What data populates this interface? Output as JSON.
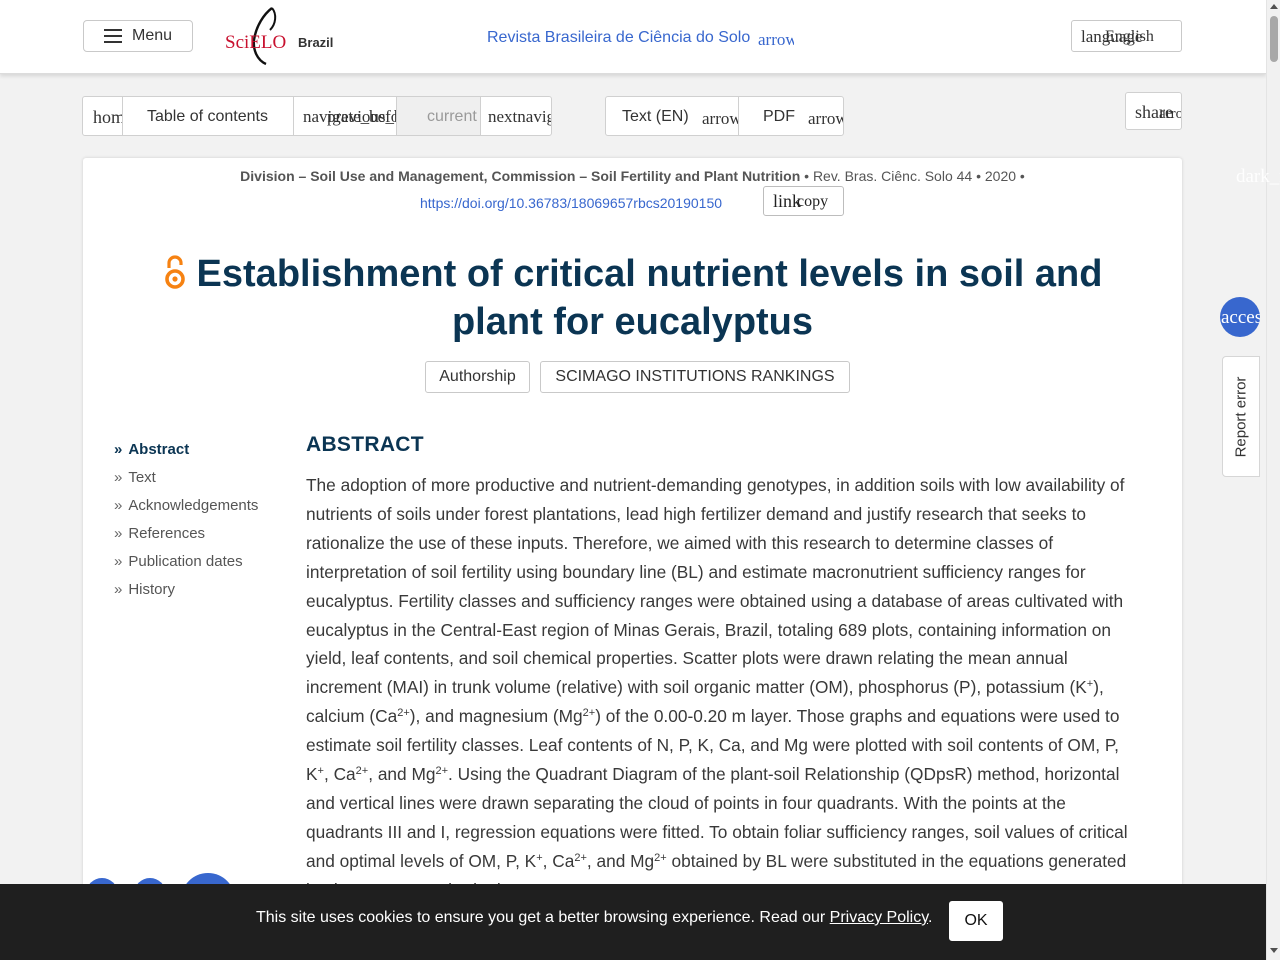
{
  "header": {
    "menu_label": "Menu",
    "logo_text": "SciELO",
    "country": "Brazil",
    "journal_name": "Revista Brasileira de Ciência do Solo",
    "journal_arrow_glyph": "arrow_drop_down",
    "language_glyph_a": "language",
    "language_label": "English",
    "language_arrow_glyph": "arrow_drop_down"
  },
  "toolbar": {
    "home_glyph": "home",
    "toc_label": "Table of contents",
    "prev_glyph_a": "navigate_before",
    "prev_glyph_b": "previous_before",
    "current_label": "current",
    "next_glyph": "nextnavigate_next",
    "text_label": "Text (EN)",
    "text_arrow_glyph": "arrow_drop_down",
    "pdf_label": "PDF",
    "pdf_arrow_glyph": "arrow_drop_down",
    "share_glyph_a": "share",
    "share_glyph_b": "arrow_drop_down"
  },
  "article": {
    "division": "Division – Soil Use and Management, Commission – Soil Fertility and Plant Nutrition",
    "citation": " • Rev. Bras. Ciênc. Solo 44 • 2020 •",
    "doi": "https://doi.org/10.36783/18069657rbcs20190150",
    "copy_glyph": "link",
    "copy_label": "copy",
    "title": "Establishment of critical nutrient levels in soil and plant for eucalyptus",
    "authorship_label": "Authorship",
    "scimago_label": "SCIMAGO INSTITUTIONS RANKINGS"
  },
  "toc": [
    {
      "label": "Abstract",
      "active": true
    },
    {
      "label": "Text",
      "active": false
    },
    {
      "label": "Acknowledgements",
      "active": false
    },
    {
      "label": "References",
      "active": false
    },
    {
      "label": "Publication dates",
      "active": false
    },
    {
      "label": "History",
      "active": false
    }
  ],
  "abstract": {
    "heading": "ABSTRACT",
    "p1": "The adoption of more productive and nutrient-demanding genotypes, in addition soils with low availability of nutrients of soils under forest plantations, lead high fertilizer demand and justify research that seeks to rationalize the use of these inputs. Therefore, we aimed with this research to determine classes of interpretation of soil fertility using boundary line (BL) and estimate macronutrient sufficiency ranges for eucalyptus. Fertility classes and sufficiency ranges were obtained using a database of areas cultivated with eucalyptus in the Central-East region of Minas Gerais, Brazil, totaling 689 plots, containing information on yield, leaf contents, and soil chemical properties. Scatter plots were drawn relating the mean annual increment (MAI) in trunk volume (relative) with soil organic matter (OM), phosphorus (P), potassium (K",
    "s1": "+",
    "p2": "), calcium (Ca",
    "s2": "2+",
    "p3": "), and magnesium (Mg",
    "s3": "2+",
    "p4": ") of the 0.00-0.20 m layer. Those graphs and equations were used to estimate soil fertility classes. Leaf contents of N, P, K, Ca, and Mg were plotted with soil contents of OM, P, K",
    "s4": "+",
    "p5": ", Ca",
    "s5": "2+",
    "p6": ", and Mg",
    "s6": "2+",
    "p7": ". Using the Quadrant Diagram of the plant-soil Relationship (QDpsR) method, horizontal and vertical lines were drawn separating the cloud of points in four quadrants. With the points at the quadrants III and I, regression equations were fitted. To obtain foliar sufficiency ranges, soil values of critical and optimal levels of OM, P, K",
    "s7": "+",
    "p8": ", Ca",
    "s8": "2+",
    "p9": ", and Mg",
    "s9": "2+",
    "p10": " obtained by BL were substituted in the equations generated by the QDpsR method. The"
  },
  "floating": {
    "dark_glyph": "dark_mode",
    "access_glyph": "accessibility",
    "report_label": "Report error"
  },
  "cookie": {
    "text": "This site uses cookies to ensure you get a better browsing experience. Read our ",
    "link": "Privacy Policy",
    "suffix": ".",
    "ok": "OK"
  },
  "colors": {
    "brand_blue": "#3867ce",
    "title_navy": "#0b3553",
    "open_access_orange": "#f68212"
  }
}
